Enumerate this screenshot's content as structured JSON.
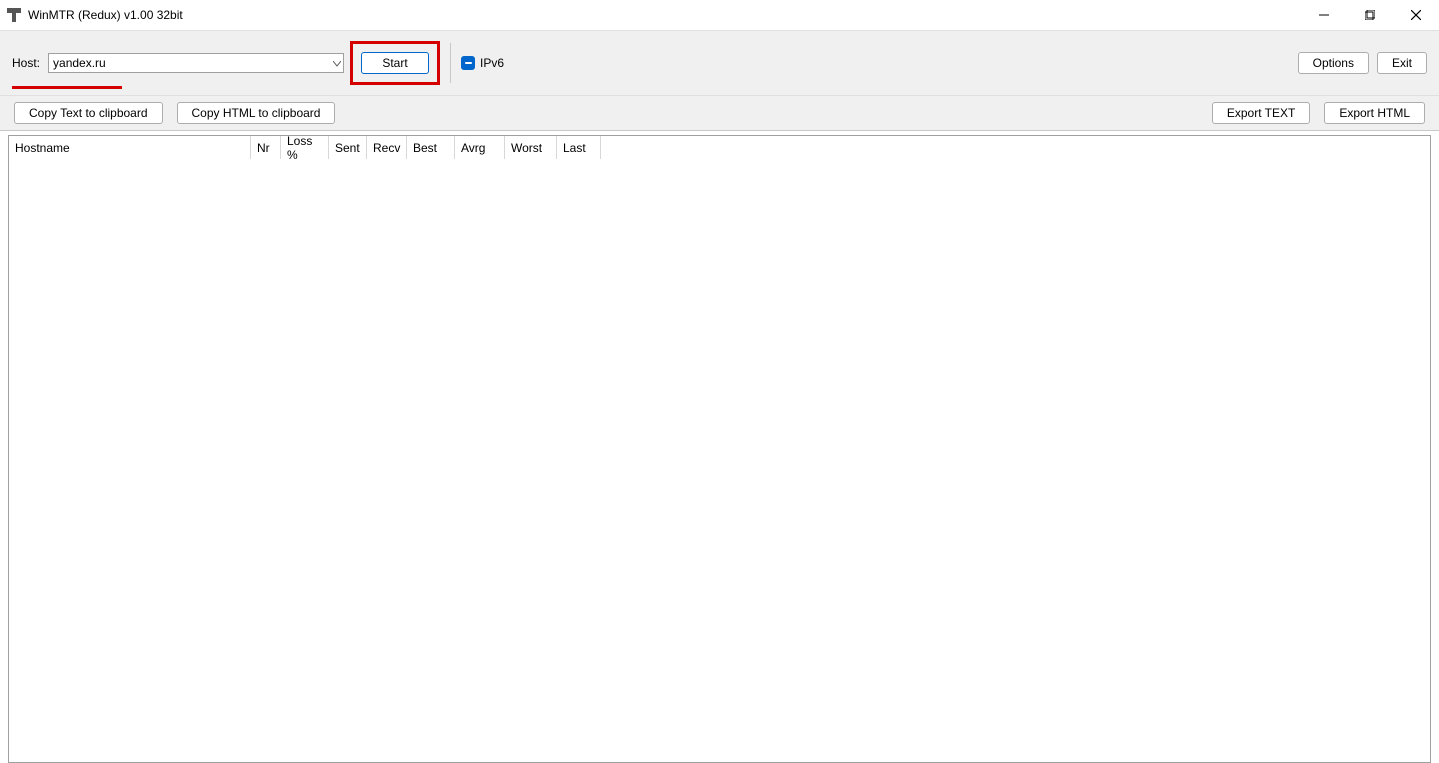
{
  "window": {
    "title": "WinMTR (Redux) v1.00 32bit"
  },
  "toolbar1": {
    "host_label": "Host:",
    "host_value": "yandex.ru",
    "start_label": "Start",
    "ipv6_label": "IPv6",
    "options_label": "Options",
    "exit_label": "Exit"
  },
  "toolbar2": {
    "copy_text_label": "Copy Text to clipboard",
    "copy_html_label": "Copy HTML to clipboard",
    "export_text_label": "Export TEXT",
    "export_html_label": "Export HTML"
  },
  "columns": {
    "hostname": "Hostname",
    "nr": "Nr",
    "loss": "Loss %",
    "sent": "Sent",
    "recv": "Recv",
    "best": "Best",
    "avrg": "Avrg",
    "worst": "Worst",
    "last": "Last"
  },
  "rows": []
}
